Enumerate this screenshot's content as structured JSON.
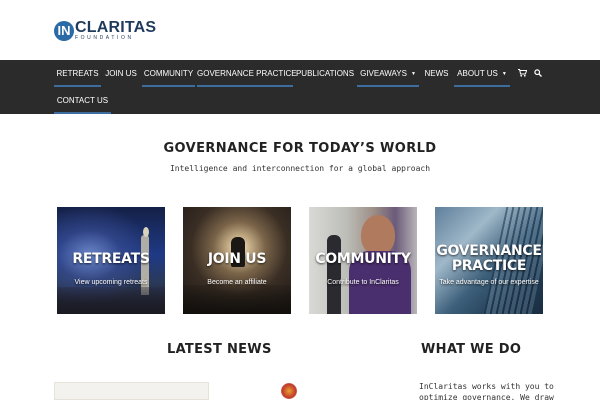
{
  "logo": {
    "letter": "IN",
    "name": "CLARITAS",
    "subtitle": "FOUNDATION"
  },
  "nav": {
    "items": [
      {
        "label": "Retreats"
      },
      {
        "label": "Join Us"
      },
      {
        "label": "Community"
      },
      {
        "label": "Governance Practice"
      },
      {
        "label": "Publications"
      },
      {
        "label": "Giveaways"
      },
      {
        "label": "News"
      },
      {
        "label": "About Us"
      },
      {
        "label": "Contact Us"
      }
    ],
    "icons": [
      "cart-icon",
      "search-icon"
    ],
    "accent_color": "#3d6d9e",
    "background_color": "#2b2b2b"
  },
  "hero": {
    "title": "GOVERNANCE FOR TODAY’S WORLD",
    "subtitle": "Intelligence and interconnection for a global approach"
  },
  "tiles": [
    {
      "title": "RETREATS",
      "subtitle": "View upcoming retreats"
    },
    {
      "title": "JOIN US",
      "subtitle": "Become an affiliate"
    },
    {
      "title": "COMMUNITY",
      "subtitle": "Contribute to InClaritas"
    },
    {
      "title_line1": "GOVERNANCE",
      "title_line2": "PRACTICE",
      "subtitle": "Take advantage of our expertise"
    }
  ],
  "sections": {
    "latest_news": "LATEST NEWS",
    "what_we_do": "WHAT WE DO",
    "what_we_do_text_line1": "InClaritas works with you to",
    "what_we_do_text_line2": "optimize governance. We draw on"
  }
}
